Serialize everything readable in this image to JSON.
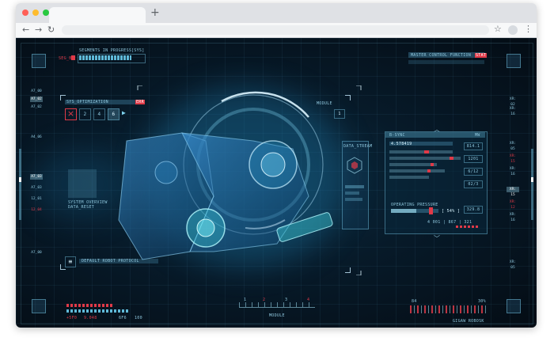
{
  "browser": {
    "window_controls": {
      "close_color": "#ff5f57",
      "minimize_color": "#febc2e",
      "maximize_color": "#28c840"
    },
    "new_tab_label": "+",
    "nav": {
      "back": "←",
      "forward": "→",
      "reload": "↻"
    },
    "star": "☆",
    "menu": "⋮"
  },
  "hud": {
    "colors": {
      "accent": "#7fd3ef",
      "alert": "#e03a48",
      "background": "#061521"
    },
    "top_left": {
      "label": "SEGMENTS IN PROGRESS",
      "code": "[SYS]",
      "side_tag": "SEG_B",
      "progress": 0.82
    },
    "top_right": {
      "label": "MASTER CONTROL FUNCTION",
      "tag": "STAT"
    },
    "left_rail": [
      "A7_00",
      "A7_02",
      "A7_02",
      "A4_06",
      "A7_03",
      "A7_03",
      "12_01",
      "12_04",
      "A7_00"
    ],
    "right_rail": [
      "XR: 02",
      "XR: 16",
      "XR: 05",
      "XR: 15",
      "XR: 16",
      "XR: 15",
      "XR: 12",
      "XR: 16",
      "XR: 05"
    ],
    "left_panel": {
      "header": "SYS_OPTIMIZATION",
      "header_tag": "ERR",
      "buttons": [
        "×",
        "2",
        "4",
        "6"
      ],
      "play": "▶",
      "caption_1": "SYSTEM OVERVIEW",
      "caption_2": "DATA_RESET"
    },
    "center_tag": "MODULE",
    "center_small_value": "1",
    "mid_panel": {
      "header": "DATA_STREAM"
    },
    "right_panel": {
      "header": "B-SYNC",
      "header_right": "MW",
      "row_label": "4.578419",
      "values": [
        "814.1",
        "1201",
        "6/12",
        "02/3",
        "329.8"
      ],
      "pressure_label": "OPERATING PRESSURE",
      "pressure_tag": "[ 54% ]",
      "footer": "4 001 | 867 | 321"
    },
    "bottom_left": {
      "value_1": "+5F0",
      "value_2": "9.048",
      "value_3": "6F6",
      "value_4": "100"
    },
    "bottom_center": {
      "label": "MODULE",
      "ticks": [
        "1",
        "2",
        "3",
        "4"
      ]
    },
    "bottom_right": {
      "left_value": "84",
      "right_value": "30%",
      "caption": "GIGAW ROBOSK"
    },
    "bottom_left_box": {
      "icon_label": "≡",
      "caption": "DEFAULT ROBOT PROTOCOL"
    }
  }
}
